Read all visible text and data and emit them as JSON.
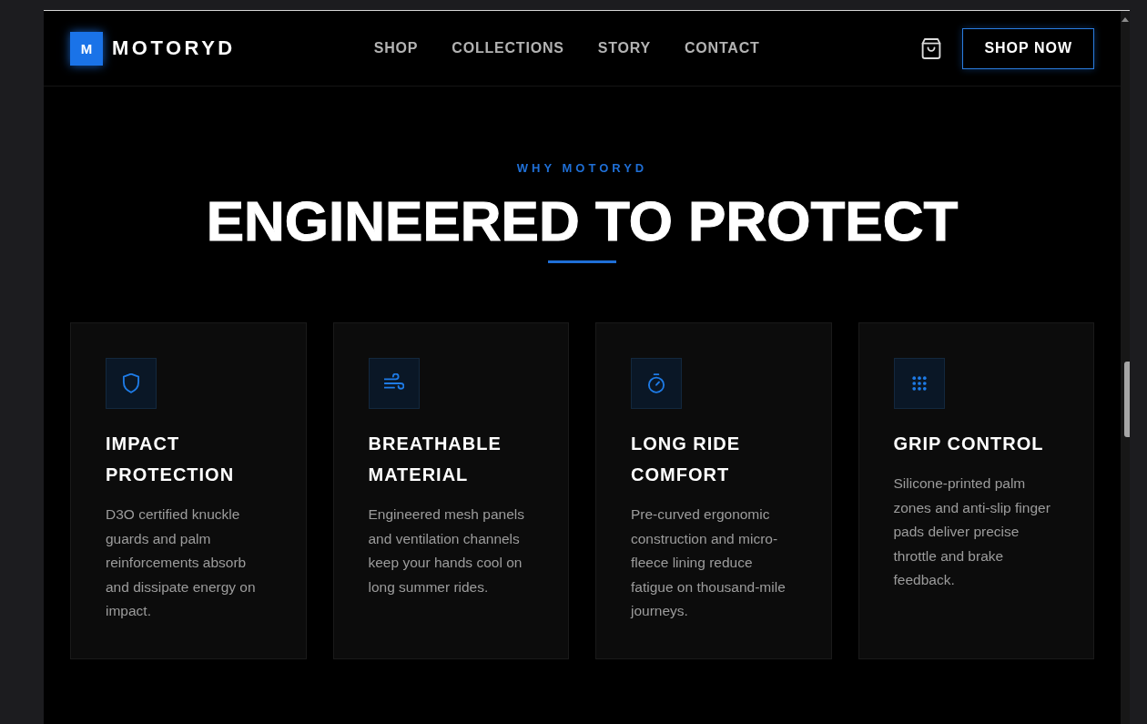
{
  "header": {
    "logo": {
      "mark": "M",
      "name": "MOTORYD"
    },
    "nav": [
      "SHOP",
      "COLLECTIONS",
      "STORY",
      "CONTACT"
    ],
    "cta": "SHOP NOW"
  },
  "features_section": {
    "eyebrow": "WHY MOTORYD",
    "title": "ENGINEERED TO PROTECT",
    "features": [
      {
        "kind": "shield",
        "title": "IMPACT PROTECTION",
        "description": "D3O certified knuckle guards and palm reinforcements absorb and dissipate energy on impact."
      },
      {
        "kind": "wind",
        "title": "BREATHABLE MATERIAL",
        "description": "Engineered mesh panels and ventilation channels keep your hands cool on long summer rides."
      },
      {
        "kind": "stopwatch",
        "title": "LONG RIDE COMFORT",
        "description": "Pre-curved ergonomic construction and micro-fleece lining reduce fatigue on thousand-mile journeys."
      },
      {
        "kind": "grid",
        "title": "GRIP CONTROL",
        "description": "Silicone-printed palm zones and anti-slip finger pads deliver precise throttle and brake feedback."
      }
    ]
  }
}
